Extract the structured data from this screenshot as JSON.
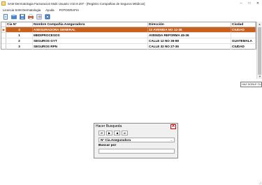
{
  "window": {
    "title": "SAM Dermatologia Facturacion Multi Usuario V10.9.207 - [Registro Compañias de Seguros Médicos]",
    "controls": [
      "–",
      "□",
      "✕"
    ]
  },
  "menu": {
    "items": [
      "Licencia SAM Dermatologia",
      "Ayuda",
      "FOTOGRAFIA"
    ]
  },
  "toolbar": {
    "buttons": [
      "new-icon",
      "open-icon",
      "save-icon",
      "print-icon",
      "export-icon",
      "close-icon"
    ]
  },
  "grid": {
    "columns": [
      "Cia N°",
      "Nombre  Compañia Aseguradora",
      "Dirección",
      "Ciudad"
    ],
    "rows": [
      {
        "cia": "4",
        "nombre": "ASEGURADORA GENERAL",
        "direccion": "12 AVENIDA NO 12-36",
        "ciudad": "CIUDAD",
        "selected": true
      },
      {
        "cia": "1",
        "nombre": "MEDIPROCESOS",
        "direccion": "AVENIDA REFORMA 45-36",
        "ciudad": ""
      },
      {
        "cia": "2",
        "nombre": "SEGUROS GYT",
        "direccion": "CALLE  12 NO 36-98",
        "ciudad": "GUATEMALA"
      },
      {
        "cia": "3",
        "nombre": "SEGUROS RPN",
        "direccion": "CALLE 32 NO 27-36",
        "ciudad": "CIUDAD"
      }
    ],
    "selected_marker": "▶"
  },
  "tooltip": {
    "text": "HAZ DOBLE CLIC PARA SELECCIONAR"
  },
  "search_dialog": {
    "title": "Hacer Busqueda",
    "close_label": "X",
    "nav": [
      "⏮",
      "▶",
      "◀",
      "⏭"
    ],
    "field_selected": "N° Cia.Aseguradora",
    "search_label": "Buscar por",
    "search_value": ""
  },
  "colors": {
    "selected_row": "#c8601e",
    "close_red": "#cc0000"
  }
}
